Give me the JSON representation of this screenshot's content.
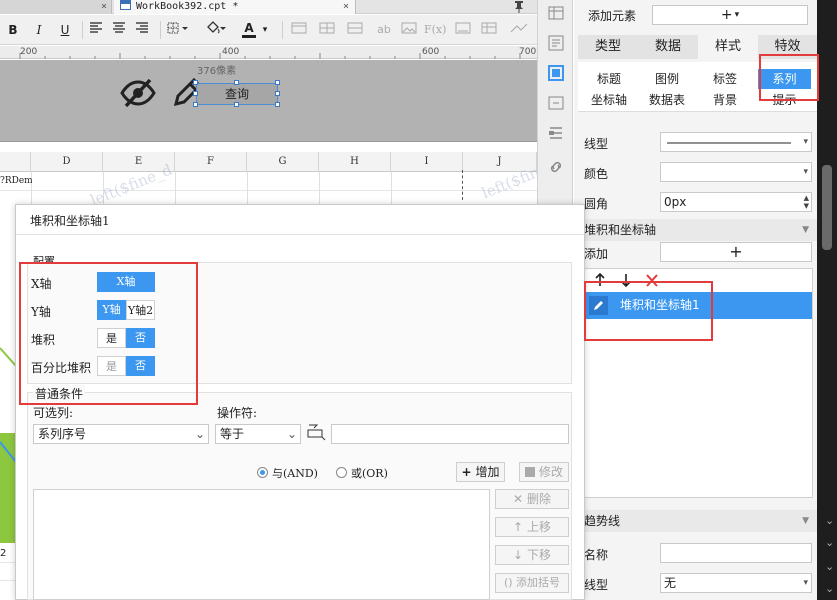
{
  "tabs": {
    "previous": "",
    "active": "WorkBook392.cpt *",
    "close_glyph": "×"
  },
  "toolbar": {
    "bold": "B",
    "italic": "I",
    "underline": "U",
    "text_color": "A",
    "text_fmt": "ab",
    "formula": "F(x)"
  },
  "ruler": [
    "200",
    "400",
    "600",
    "700"
  ],
  "canvas": {
    "width_label": "376像素",
    "query_button": "查询"
  },
  "sheet": {
    "columns": [
      "D",
      "E",
      "F",
      "G",
      "H",
      "I",
      "J"
    ],
    "cell_a2": "?RDem",
    "watermark": "left($fine_d",
    "watermark2": "left($fine",
    "left_label": "2"
  },
  "panel": {
    "add_element_label": "添加元素",
    "add_element_btn": "+",
    "main_tabs": [
      "类型",
      "数据",
      "样式",
      "特效"
    ],
    "sub_tabs_row1": [
      "标题",
      "图例",
      "标签",
      "系列"
    ],
    "sub_tabs_row2": [
      "坐标轴",
      "数据表",
      "背景",
      "提示"
    ],
    "line_type_label": "线型",
    "color_label": "颜色",
    "corner_label": "圆角",
    "corner_value": "0px",
    "stack_section": "堆积和坐标轴",
    "add_label": "添加",
    "add_btn": "+",
    "list_item": "堆积和坐标轴1",
    "trend_section": "趋势线",
    "name_label": "名称",
    "trend_line_label": "线型",
    "trend_line_value": "无"
  },
  "dialog": {
    "title": "堆积和坐标轴1",
    "config_legend": "配置",
    "x_axis_label": "X轴",
    "x_axis_value": "X轴",
    "y_axis_label": "Y轴",
    "y_axis_options": [
      "Y轴",
      "Y轴2"
    ],
    "stack_label": "堆积",
    "percent_stack_label": "百分比堆积",
    "yes": "是",
    "no": "否",
    "normal_condition_legend": "普通条件",
    "optional_col_label": "可选列:",
    "optional_col_value": "系列序号",
    "operator_label": "操作符:",
    "operator_value": "等于",
    "and_label": "与(AND)",
    "or_label": "或(OR)",
    "add_btn": "增加",
    "modify_btn": "修改",
    "delete_btn": "删除",
    "up_btn": "上移",
    "down_btn": "下移",
    "bracket_btn": "添加括号"
  },
  "colors": {
    "accent": "#3b97ef",
    "highlight": "#e33b3b",
    "bar_green": "#8dc63f"
  }
}
